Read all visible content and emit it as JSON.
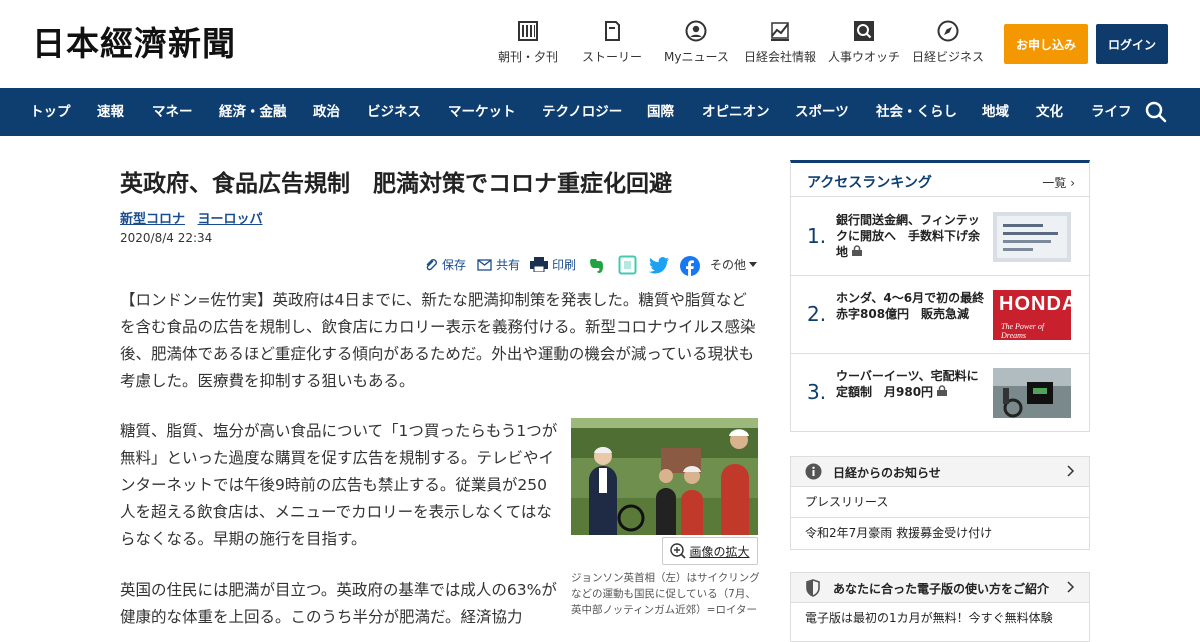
{
  "header": {
    "logo": "日本經濟新聞",
    "nav": [
      {
        "label": "朝刊・夕刊",
        "icon": "newspaper-icon"
      },
      {
        "label": "ストーリー",
        "icon": "story-icon"
      },
      {
        "label": "Myニュース",
        "icon": "user-icon"
      },
      {
        "label": "日経会社情報",
        "icon": "chart-icon"
      },
      {
        "label": "人事ウオッチ",
        "icon": "search-person-icon"
      },
      {
        "label": "日経ビジネス",
        "icon": "compass-icon"
      }
    ],
    "apply_label": "お申し込み",
    "login_label": "ログイン"
  },
  "global_nav": [
    "トップ",
    "速報",
    "マネー",
    "経済・金融",
    "政治",
    "ビジネス",
    "マーケット",
    "テクノロジー",
    "国際",
    "オピニオン",
    "スポーツ",
    "社会・くらし",
    "地域",
    "文化",
    "ライフ"
  ],
  "article": {
    "title": "英政府、食品広告規制　肥満対策でコロナ重症化回避",
    "tags": [
      "新型コロナ",
      "ヨーロッパ"
    ],
    "date": "2020/8/4 22:34",
    "share": {
      "save": "保存",
      "share": "共有",
      "print": "印刷",
      "more": "その他"
    },
    "paragraphs": [
      "【ロンドン=佐竹実】英政府は4日までに、新たな肥満抑制策を発表した。糖質や脂質などを含む食品の広告を規制し、飲食店にカロリー表示を義務付ける。新型コロナウイルス感染後、肥満体であるほど重症化する傾向があるためだ。外出や運動の機会が減っている現状も考慮した。医療費を抑制する狙いもある。",
      "糖質、脂質、塩分が高い食品について「1つ買ったらもう1つが無料」といった過度な購買を促す広告を規制する。テレビやインターネットでは午後9時前の広告も禁止する。従業員が250人を超える飲食店は、メニューでカロリーを表示しなくてはならなくなる。早期の施行を目指す。",
      "英国の住民には肥満が目立つ。英政府の基準では成人の63%が健康的な体重を上回る。このうち半分が肥満だ。経済協力"
    ],
    "photo_zoom": "画像の拡大",
    "photo_caption": "ジョンソン英首相（左）はサイクリングなどの運動も国民に促している（7月、英中部ノッティンガム近郊）=ロイター"
  },
  "ranking": {
    "title": "アクセスランキング",
    "more": "一覧",
    "items": [
      {
        "num": "1.",
        "text": "銀行間送金網、フィンテックに開放へ　手数料下げ余地"
      },
      {
        "num": "2.",
        "text": "ホンダ、4～6月で初の最終赤字808億円　販売急減"
      },
      {
        "num": "3.",
        "text": "ウーバーイーツ、宅配料に定額制　月980円"
      }
    ],
    "honda_logo": "HONDA",
    "honda_tagline": "The Power of Dreams"
  },
  "notice": {
    "title": "日経からのお知らせ",
    "items": [
      "プレスリリース",
      "令和2年7月豪雨 救援募金受け付け"
    ]
  },
  "digital": {
    "title": "あなたに合った電子版の使い方をご紹介",
    "items": [
      "電子版は最初の1カ月が無料！今すぐ無料体験"
    ]
  }
}
